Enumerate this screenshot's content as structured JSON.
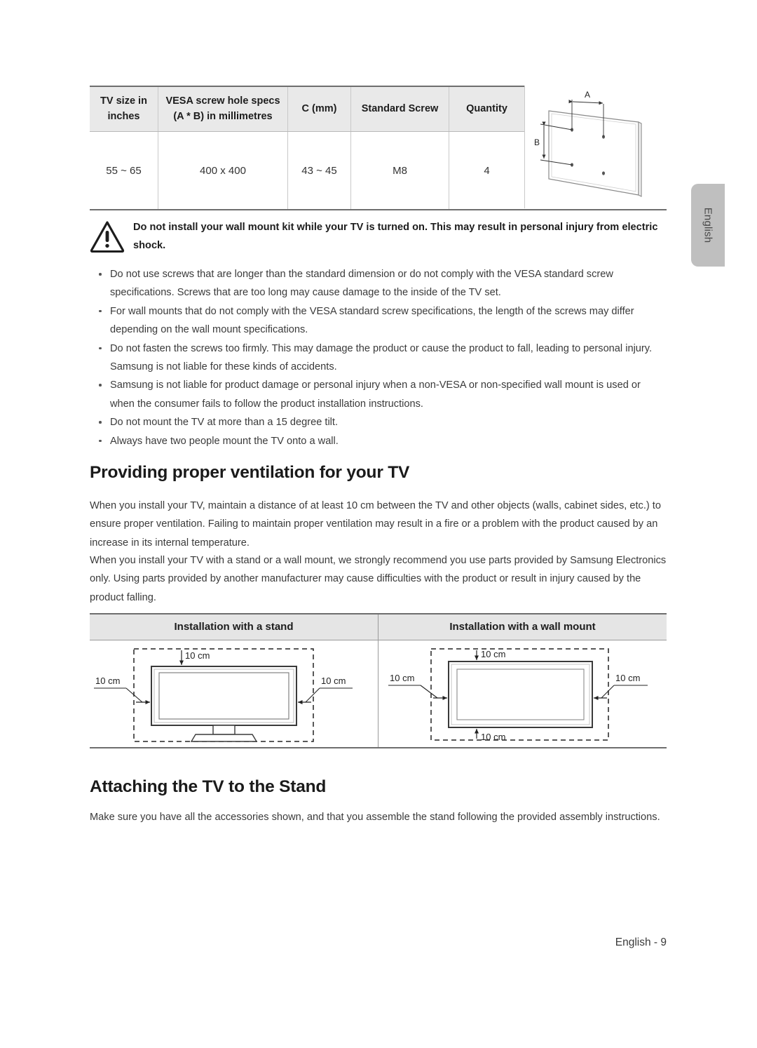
{
  "language_tab": {
    "label": "English"
  },
  "specs_table": {
    "headers": [
      "TV size in inches",
      "VESA screw hole specs (A * B) in millimetres",
      "C (mm)",
      "Standard Screw",
      "Quantity",
      ""
    ],
    "header_lines": {
      "col1_line1": "TV size in",
      "col1_line2": "inches",
      "col2_line1": "VESA screw hole specs",
      "col2_line2": "(A * B) in millimetres",
      "col3": "C (mm)",
      "col4": "Standard Screw",
      "col5": "Quantity"
    },
    "rows": [
      {
        "tv_size": "55 ~ 65",
        "vesa": "400 x 400",
        "c_mm": "43 ~ 45",
        "screw": "M8",
        "quantity": "4"
      }
    ],
    "diagram": {
      "label_a": "A",
      "label_b": "B",
      "name": "tv-back-panel-vesa-diagram"
    }
  },
  "warning": {
    "icon": "warning-triangle-icon",
    "text": "Do not install your wall mount kit while your TV is turned on. This may result in personal injury from electric shock."
  },
  "cautions": [
    "Do not use screws that are longer than the standard dimension or do not comply with the VESA standard screw specifications. Screws that are too long may cause damage to the inside of the TV set.",
    "For wall mounts that do not comply with the VESA standard screw specifications, the length of the screws may differ depending on the wall mount specifications.",
    "Do not fasten the screws too firmly. This may damage the product or cause the product to fall, leading to personal injury. Samsung is not liable for these kinds of accidents.",
    "Samsung is not liable for product damage or personal injury when a non-VESA or non-specified wall mount is used or when the consumer fails to follow the product installation instructions.",
    "Do not mount the TV at more than a 15 degree tilt.",
    "Always have two people mount the TV onto a wall."
  ],
  "ventilation": {
    "heading": "Providing proper ventilation for your TV",
    "paragraph_1": "When you install your TV, maintain a distance of at least 10 cm between the TV and other objects (walls, cabinet sides, etc.) to ensure proper ventilation. Failing to maintain proper ventilation may result in a fire or a problem with the product caused by an increase in its internal temperature.",
    "paragraph_2": "When you install your TV with a stand or a wall mount, we strongly recommend you use parts provided by Samsung Electronics only. Using parts provided by another manufacturer may cause difficulties with the product or result in injury caused by the product falling."
  },
  "installation_table": {
    "headers": [
      "Installation with a stand",
      "Installation with a wall mount"
    ],
    "stand_diagram": {
      "top_label": "10 cm",
      "left_label": "10 cm",
      "right_label": "10 cm"
    },
    "wall_diagram": {
      "top_label": "10 cm",
      "left_label": "10 cm",
      "right_label": "10 cm",
      "bottom_label": "10 cm"
    }
  },
  "attaching": {
    "heading": "Attaching the TV to the Stand",
    "paragraph": "Make sure you have all the accessories shown, and that you assemble the stand following the provided assembly instructions."
  },
  "footer": {
    "page_label": "English - 9"
  },
  "colors": {
    "text": "#3a3a3a",
    "heading": "#1a1a1a",
    "table_header_bg": "#e9e9e9",
    "table_border": "#6e6e6e",
    "tab_bg": "#bfbfbf"
  }
}
